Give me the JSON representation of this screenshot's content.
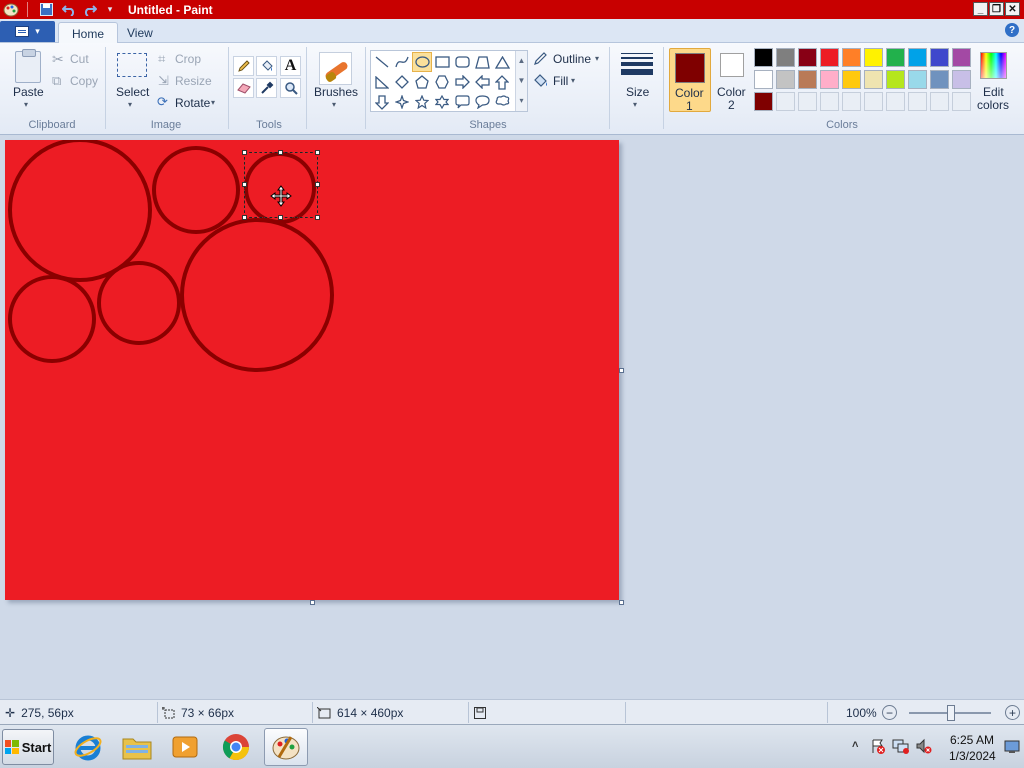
{
  "window": {
    "title": "Untitled - Paint",
    "controls": {
      "minimize": "_",
      "restore": "❐",
      "close": "✕"
    }
  },
  "tabs": [
    {
      "label": "Home",
      "active": true
    },
    {
      "label": "View",
      "active": false
    }
  ],
  "ribbon": {
    "clipboard": {
      "paste": "Paste",
      "cut": "Cut",
      "copy": "Copy",
      "group_label": "Clipboard"
    },
    "image": {
      "select": "Select",
      "crop": "Crop",
      "resize": "Resize",
      "rotate": "Rotate",
      "group_label": "Image"
    },
    "tools": {
      "group_label": "Tools"
    },
    "brushes": {
      "label": "Brushes"
    },
    "shapes": {
      "outline": "Outline",
      "fill": "Fill",
      "group_label": "Shapes"
    },
    "size": {
      "label": "Size"
    },
    "colors": {
      "color1_label_line1": "Color",
      "color1_label_line2": "1",
      "color2_label_line1": "Color",
      "color2_label_line2": "2",
      "edit_label_line1": "Edit",
      "edit_label_line2": "colors",
      "group_label": "Colors",
      "color1_value": "#7f0000",
      "color2_value": "#ffffff",
      "palette_row1": [
        "#000000",
        "#7f7f7f",
        "#880015",
        "#ed1c24",
        "#ff7f27",
        "#fff200",
        "#22b14c",
        "#00a2e8",
        "#3f48cc",
        "#a349a4"
      ],
      "palette_row2": [
        "#ffffff",
        "#c3c3c3",
        "#b97a57",
        "#ffaec9",
        "#ffc90e",
        "#efe4b0",
        "#b5e61d",
        "#99d9ea",
        "#7092be",
        "#c8bfe7"
      ],
      "palette_row3": [
        "#7f0000"
      ]
    }
  },
  "canvas": {
    "fill_color": "#ed1c24",
    "circle_color": "#8b0000"
  },
  "statusbar": {
    "cursor_pos": "275, 56px",
    "selection_size": "73 × 66px",
    "canvas_size": "614 × 460px",
    "zoom": "100%"
  },
  "taskbar": {
    "start": "Start",
    "clock_time": "6:25 AM",
    "clock_date": "1/3/2024"
  }
}
